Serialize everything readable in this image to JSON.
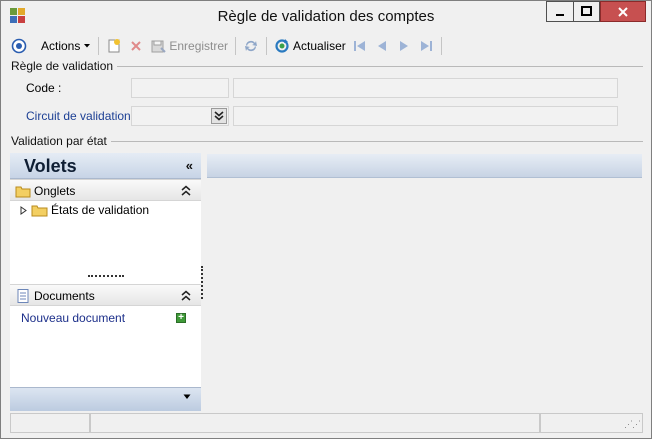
{
  "window": {
    "title": "Règle de validation des comptes"
  },
  "toolbar": {
    "actions_label": "Actions",
    "save_label": "Enregistrer",
    "refresh_label": "Actualiser"
  },
  "regle": {
    "group_title": "Règle de validation",
    "code_label": "Code :",
    "code_value": "",
    "code_desc": "",
    "circuit_label": "Circuit de validation :",
    "circuit_value": "",
    "circuit_desc": ""
  },
  "validation": {
    "group_title": "Validation par état"
  },
  "volets": {
    "title": "Volets",
    "onglets_label": "Onglets",
    "tree_item_label": "États de validation",
    "documents_label": "Documents",
    "new_document_label": "Nouveau document"
  },
  "icons": {
    "app": "app-icon",
    "record": "record-icon",
    "new": "new-doc-icon",
    "delete": "delete-icon",
    "save": "save-icon",
    "sync": "sync-icon",
    "refresh": "refresh-icon",
    "nav_first": "first-icon",
    "nav_prev": "prev-icon",
    "nav_next": "next-icon",
    "nav_last": "last-icon"
  },
  "colors": {
    "accent": "#1c3f94",
    "header_blue": "#c7d4e6",
    "close_red": "#c75050"
  }
}
